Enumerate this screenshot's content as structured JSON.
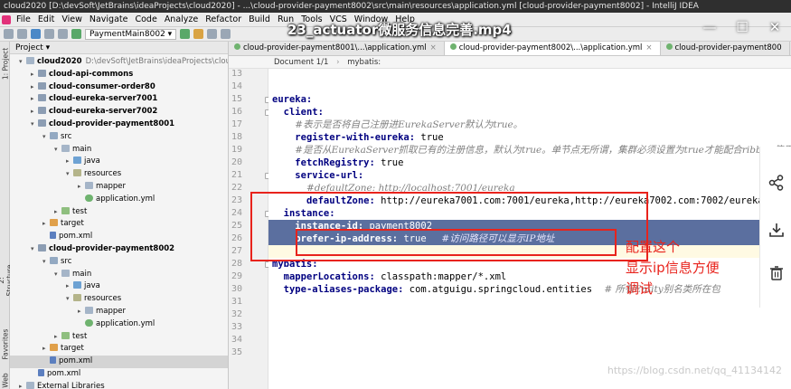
{
  "window": {
    "title": "cloud2020 [D:\\devSoft\\JetBrains\\ideaProjects\\cloud2020] - ...\\cloud-provider-payment8002\\src\\main\\resources\\application.yml [cloud-provider-payment8002] - IntelliJ IDEA",
    "video_title": "23_actuator微服务信息完善.mp4",
    "controls": [
      "—",
      "☐",
      "✕"
    ]
  },
  "menu": [
    "File",
    "Edit",
    "View",
    "Navigate",
    "Code",
    "Analyze",
    "Refactor",
    "Build",
    "Run",
    "Tools",
    "VCS",
    "Window",
    "Help"
  ],
  "toolbar": {
    "run_config": "PaymentMain8002 ▾"
  },
  "side_stripe": {
    "labels": [
      "1: Project",
      "2: Structure",
      "Favorites",
      "Web"
    ]
  },
  "project_panel": {
    "header": "Project ▾",
    "tree": [
      {
        "label": "cloud2020",
        "path": "D:\\devSoft\\JetBrains\\ideaProjects\\cloud2020",
        "arrow": "▾",
        "indent": 0,
        "icon": "folder",
        "bold": true
      },
      {
        "label": "cloud-api-commons",
        "arrow": "▸",
        "indent": 1,
        "icon": "module",
        "bold": true
      },
      {
        "label": "cloud-consumer-order80",
        "arrow": "▸",
        "indent": 1,
        "icon": "module",
        "bold": true
      },
      {
        "label": "cloud-eureka-server7001",
        "arrow": "▸",
        "indent": 1,
        "icon": "module",
        "bold": true
      },
      {
        "label": "cloud-eureka-server7002",
        "arrow": "▸",
        "indent": 1,
        "icon": "module",
        "bold": true
      },
      {
        "label": "cloud-provider-payment8001",
        "arrow": "▾",
        "indent": 1,
        "icon": "module",
        "bold": true
      },
      {
        "label": "src",
        "arrow": "▾",
        "indent": 2,
        "icon": "src"
      },
      {
        "label": "main",
        "arrow": "▾",
        "indent": 3,
        "icon": "folder"
      },
      {
        "label": "java",
        "arrow": "▸",
        "indent": 4,
        "icon": "java"
      },
      {
        "label": "resources",
        "arrow": "▾",
        "indent": 4,
        "icon": "res"
      },
      {
        "label": "mapper",
        "arrow": "▸",
        "indent": 5,
        "icon": "folder"
      },
      {
        "label": "application.yml",
        "arrow": "",
        "indent": 5,
        "icon": "yml"
      },
      {
        "label": "test",
        "arrow": "▸",
        "indent": 3,
        "icon": "test"
      },
      {
        "label": "target",
        "arrow": "▸",
        "indent": 2,
        "icon": "target"
      },
      {
        "label": "pom.xml",
        "arrow": "",
        "indent": 2,
        "icon": "pom"
      },
      {
        "label": "cloud-provider-payment8002",
        "arrow": "▾",
        "indent": 1,
        "icon": "module",
        "bold": true
      },
      {
        "label": "src",
        "arrow": "▾",
        "indent": 2,
        "icon": "src"
      },
      {
        "label": "main",
        "arrow": "▾",
        "indent": 3,
        "icon": "folder"
      },
      {
        "label": "java",
        "arrow": "▸",
        "indent": 4,
        "icon": "java"
      },
      {
        "label": "resources",
        "arrow": "▾",
        "indent": 4,
        "icon": "res"
      },
      {
        "label": "mapper",
        "arrow": "▸",
        "indent": 5,
        "icon": "folder"
      },
      {
        "label": "application.yml",
        "arrow": "",
        "indent": 5,
        "icon": "yml"
      },
      {
        "label": "test",
        "arrow": "▸",
        "indent": 3,
        "icon": "test"
      },
      {
        "label": "target",
        "arrow": "▸",
        "indent": 2,
        "icon": "target"
      },
      {
        "label": "pom.xml",
        "arrow": "",
        "indent": 2,
        "icon": "pom",
        "selected": true
      },
      {
        "label": "pom.xml",
        "arrow": "",
        "indent": 1,
        "icon": "pom"
      },
      {
        "label": "External Libraries",
        "arrow": "▸",
        "indent": 0,
        "icon": "folder"
      }
    ]
  },
  "tabs": [
    {
      "label": "cloud-provider-payment8001\\...\\application.yml",
      "active": false
    },
    {
      "label": "cloud-provider-payment8002\\...\\application.yml",
      "active": true
    },
    {
      "label": "cloud-provider-payment800",
      "active": false
    }
  ],
  "breadcrumb": {
    "doc": "Document 1/1",
    "sep": "›",
    "node": "mybatis:"
  },
  "editor": {
    "line_numbers": [
      "13",
      "14",
      "15",
      "16",
      "17",
      "18",
      "19",
      "20",
      "21",
      "22",
      "23",
      "24",
      "25",
      "26",
      "27",
      "28",
      "29",
      "30",
      "31",
      "32",
      "33",
      "34",
      "35"
    ],
    "lines": [
      {
        "indent": "",
        "parts": []
      },
      {
        "indent": "",
        "parts": []
      },
      {
        "indent": "",
        "parts": [
          {
            "t": "eureka:",
            "c": "k"
          }
        ]
      },
      {
        "indent": "  ",
        "parts": [
          {
            "t": "client:",
            "c": "k"
          }
        ]
      },
      {
        "indent": "    ",
        "parts": [
          {
            "t": "#表示是否将自己注册进EurekaServer默认为true。",
            "c": "c"
          }
        ]
      },
      {
        "indent": "    ",
        "parts": [
          {
            "t": "register-with-eureka:",
            "c": "k"
          },
          {
            "t": " true",
            "c": "v"
          }
        ]
      },
      {
        "indent": "    ",
        "parts": [
          {
            "t": "#是否从EurekaServer抓取已有的注册信息，默认为true。单节点无所谓，集群必须设置为true才能配合ribbon使用负载均衡",
            "c": "c"
          }
        ]
      },
      {
        "indent": "    ",
        "parts": [
          {
            "t": "fetchRegistry:",
            "c": "k"
          },
          {
            "t": " true",
            "c": "v"
          }
        ]
      },
      {
        "indent": "    ",
        "parts": [
          {
            "t": "service-url:",
            "c": "k"
          }
        ]
      },
      {
        "indent": "      ",
        "parts": [
          {
            "t": "#defaultZone: http://localhost:7001/eureka",
            "c": "c"
          }
        ]
      },
      {
        "indent": "      ",
        "parts": [
          {
            "t": "defaultZone:",
            "c": "k"
          },
          {
            "t": " http://eureka7001.com:7001/eureka,http://eureka7002.com:7002/eureka",
            "c": "v"
          }
        ]
      },
      {
        "indent": "  ",
        "parts": [
          {
            "t": "instance:",
            "c": "k"
          }
        ]
      },
      {
        "indent": "    ",
        "parts": [
          {
            "t": "instance-id:",
            "c": "k"
          },
          {
            "t": " payment8002",
            "c": "v"
          }
        ]
      },
      {
        "indent": "    ",
        "parts": [
          {
            "t": "prefer-ip-address:",
            "c": "k"
          },
          {
            "t": " true",
            "c": "v"
          },
          {
            "t": "     #访问路径可以显示IP地址",
            "c": "c"
          }
        ]
      },
      {
        "indent": "",
        "parts": []
      },
      {
        "indent": "",
        "parts": [
          {
            "t": "mybatis:",
            "c": "k"
          }
        ]
      },
      {
        "indent": "  ",
        "parts": [
          {
            "t": "mapperLocations:",
            "c": "k"
          },
          {
            "t": " classpath:mapper/*.xml",
            "c": "v"
          }
        ]
      },
      {
        "indent": "  ",
        "parts": [
          {
            "t": "type-aliases-package:",
            "c": "k"
          },
          {
            "t": " com.atguigu.springcloud.entities",
            "c": "v"
          },
          {
            "t": "    # 所有Entity别名类所在包",
            "c": "c"
          }
        ]
      },
      {
        "indent": "",
        "parts": []
      },
      {
        "indent": "",
        "parts": []
      },
      {
        "indent": "",
        "parts": []
      },
      {
        "indent": "",
        "parts": []
      },
      {
        "indent": "",
        "parts": []
      }
    ],
    "selected_lines": [
      12,
      13
    ],
    "caret_line": 14
  },
  "annotation": {
    "lines": [
      "配置这个",
      "显示ip信息方便",
      "调试"
    ],
    "color": "#e8231c"
  },
  "share_bar": {
    "icons": [
      "share-icon",
      "download-icon",
      "delete-icon"
    ]
  },
  "watermark": "https://blog.csdn.net/qq_41134142"
}
